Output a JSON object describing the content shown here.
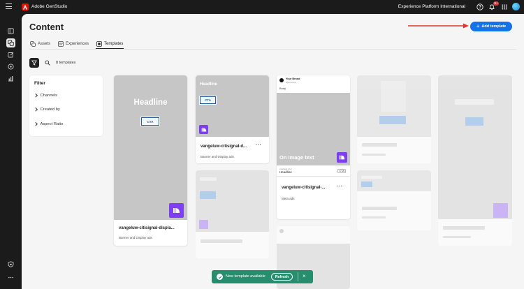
{
  "app": {
    "title": "Adobe GenStudio",
    "org": "Experience Platform International",
    "notif_count": "9+"
  },
  "page": {
    "title": "Content",
    "add_button": "Add template"
  },
  "tabs": [
    {
      "label": "Assets",
      "icon": "assets-icon"
    },
    {
      "label": "Experiences",
      "icon": "experiences-icon"
    },
    {
      "label": "Templates",
      "icon": "templates-icon",
      "active": true
    }
  ],
  "toolbar": {
    "count": "8 templates"
  },
  "filter": {
    "title": "Filter",
    "items": [
      "Channels",
      "Created by",
      "Aspect Ratio"
    ]
  },
  "cards": [
    {
      "name": "vangeluw-citisignal-displa...",
      "type": "Banner and Display ads",
      "headline": "Headline",
      "cta": "CTA"
    },
    {
      "name": "vangeluw-citisignal-d...",
      "type": "Banner and Display ads",
      "headline": "Headline",
      "cta": "CTA"
    },
    {
      "name": "vangeluw-citisignal-...",
      "type": "Meta ads",
      "brand_name": "Your Brand",
      "brand_handle": "Sponsored",
      "body": "Body",
      "image_text": "On Image text",
      "url": "example.com",
      "headline": "Headline",
      "cta": "CTA"
    }
  ],
  "toast": {
    "message": "New template available",
    "action": "Refresh"
  },
  "colors": {
    "accent": "#1473e6",
    "toast": "#268e6c",
    "brand_tile": "#7e3ff2",
    "arrow": "#e8322a"
  }
}
